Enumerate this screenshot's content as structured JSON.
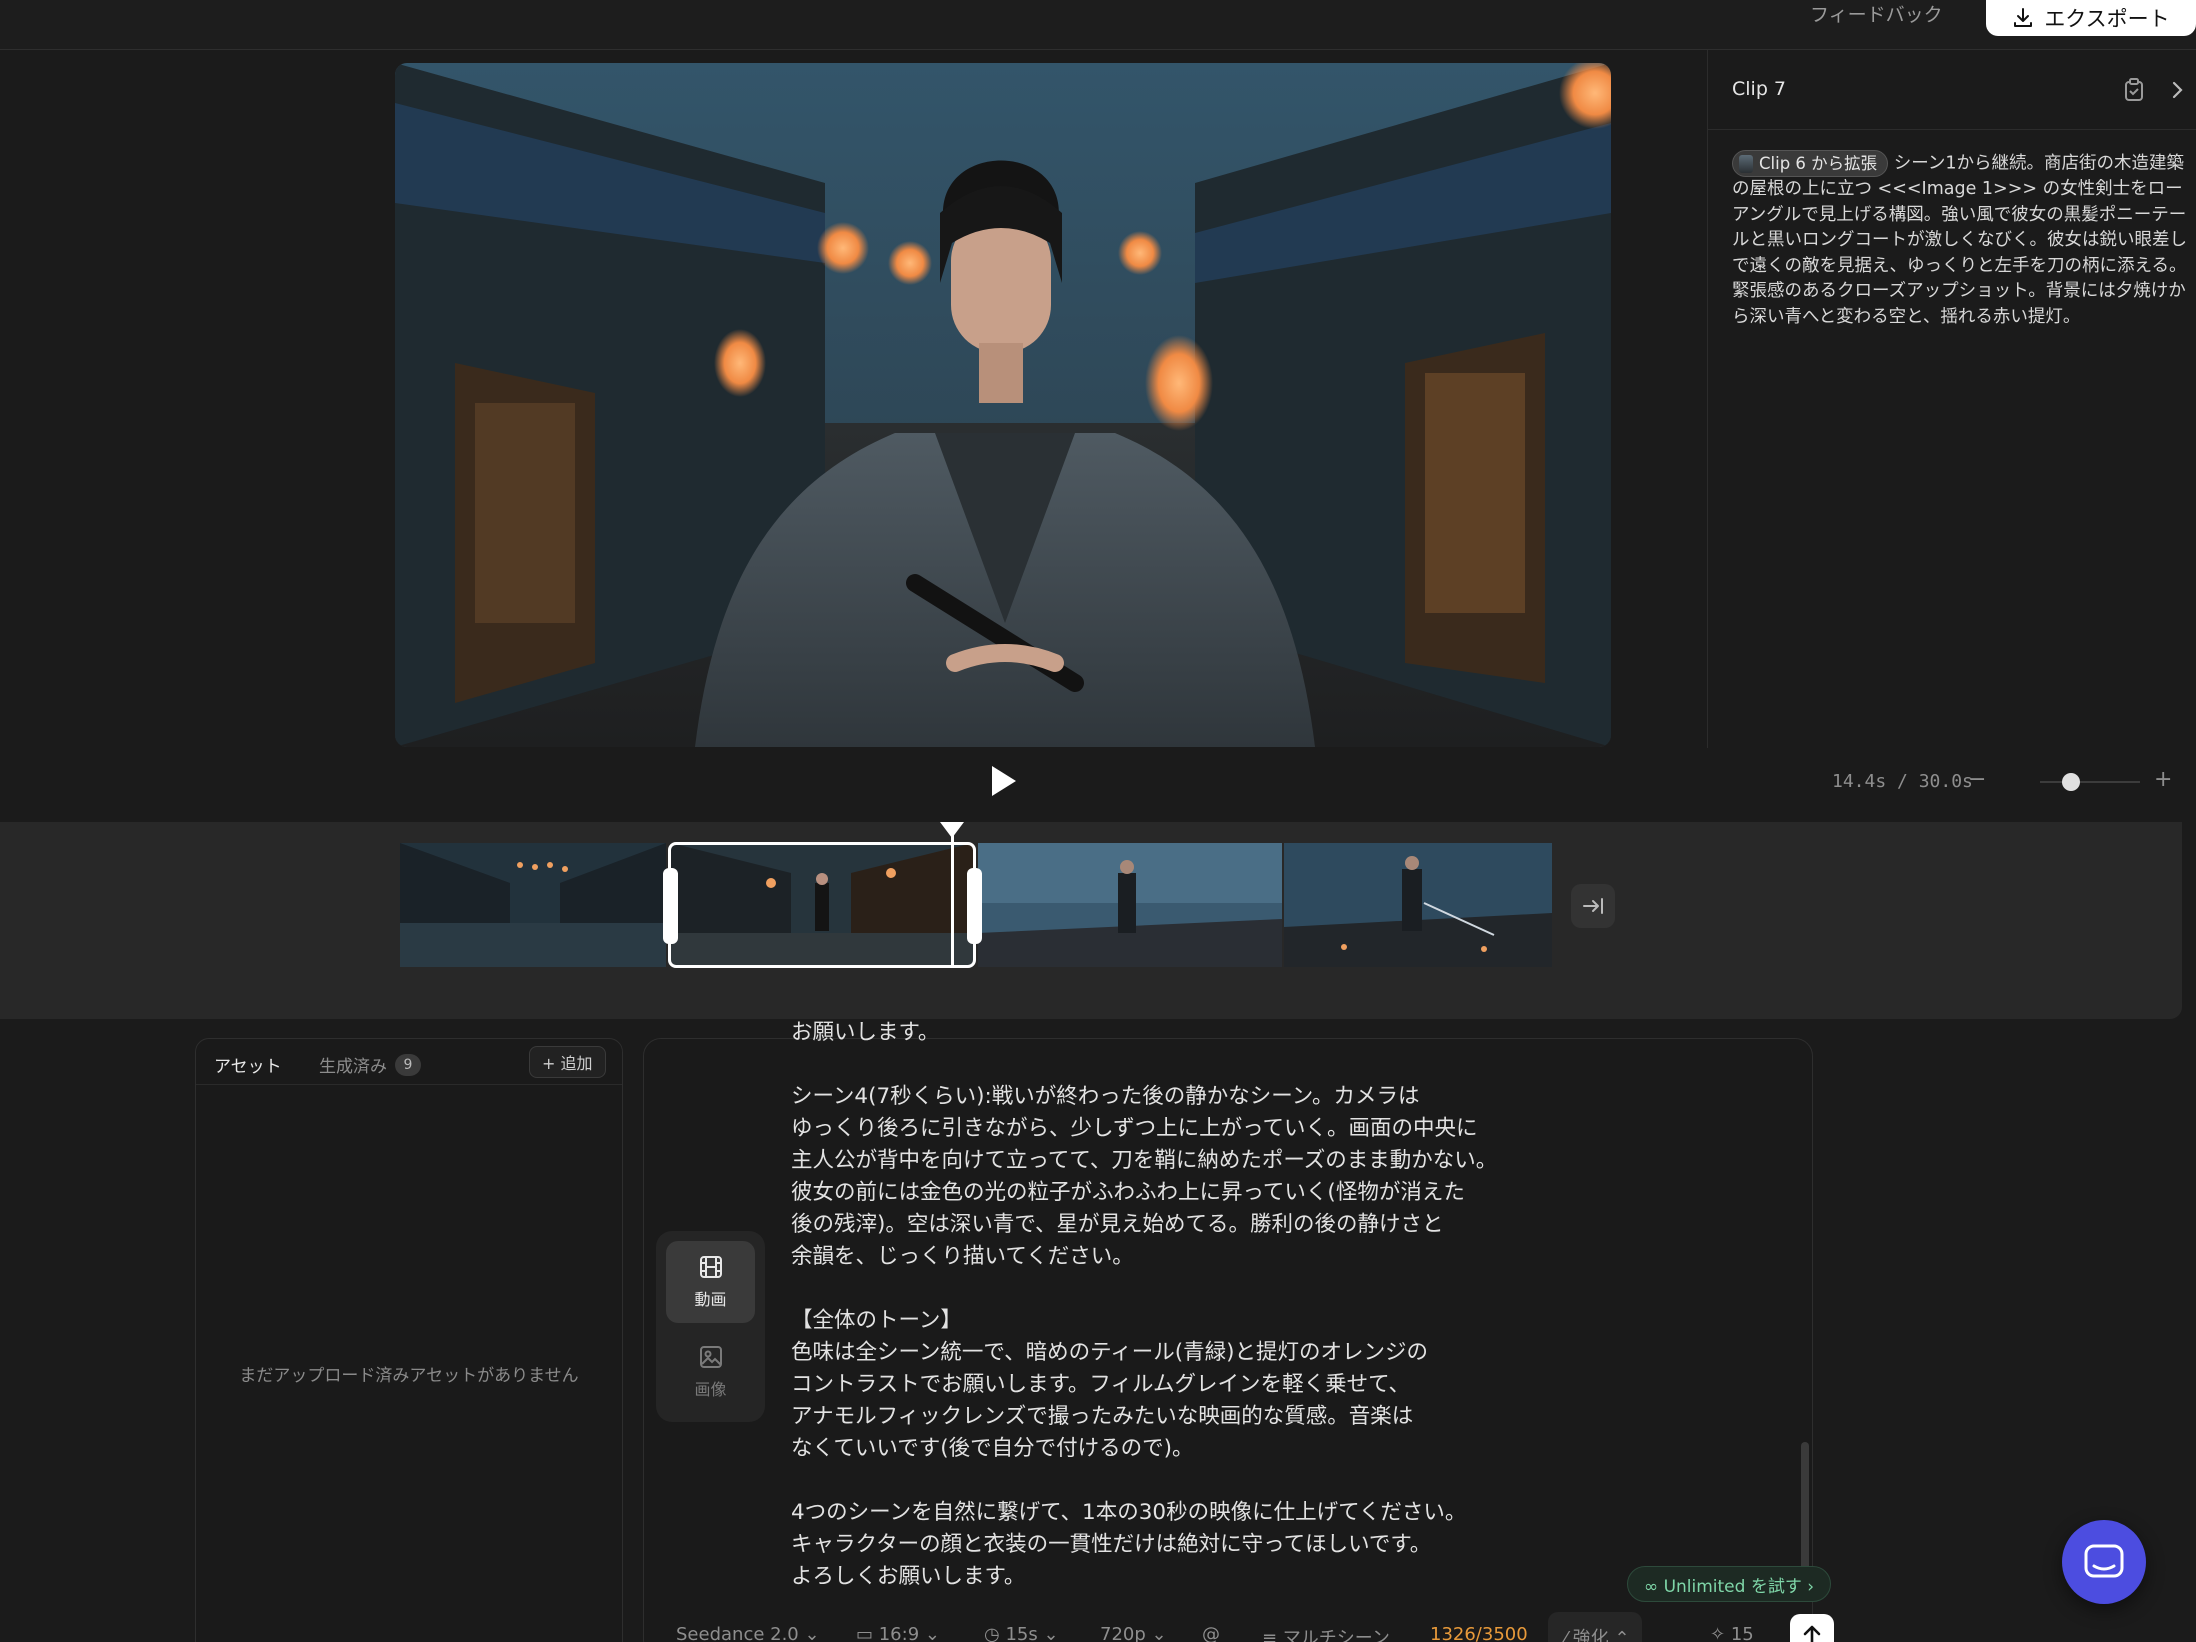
{
  "topbar": {
    "feedback_label": "フィードバック",
    "export_label": "エクスポート"
  },
  "clip_panel": {
    "title": "Clip 7",
    "chip_label": "Clip 6 から拡張",
    "description": "シーン1から継続。商店街の木造建築の屋根の上に立つ <<<Image 1>>> の女性剣士をローアングルで見上げる構図。強い風で彼女の黒髪ポニーテールと黒いロングコートが激しくなびく。彼女は鋭い眼差しで遠くの敵を見据え、ゆっくりと左手を刀の柄に添える。緊張感のあるクローズアップショット。背景には夕焼けから深い青へと変わる空と、揺れる赤い提灯。"
  },
  "playback": {
    "time_readout": "14.4s / 30.0s",
    "zoom_out": "−",
    "zoom_in": "+",
    "zoom_level": 0.3
  },
  "timeline": {
    "clips": [
      {
        "name": "clip-5"
      },
      {
        "name": "clip-6",
        "selected": true
      },
      {
        "name": "clip-7"
      },
      {
        "name": "clip-8"
      }
    ]
  },
  "assets": {
    "tab_assets": "アセット",
    "tab_generated": "生成済み",
    "generated_count": "9",
    "add_label": "+ 追加",
    "empty_text": "まだアップロード済みアセットがありません"
  },
  "modes": {
    "video": "動画",
    "image": "画像"
  },
  "prompt": {
    "text": "お願いします。\n\nシーン4(7秒くらい):戦いが終わった後の静かなシーン。カメラは\nゆっくり後ろに引きながら、少しずつ上に上がっていく。画面の中央に\n主人公が背中を向けて立ってて、刀を鞘に納めたポーズのまま動かない。\n彼女の前には金色の光の粒子がふわふわ上に昇っていく(怪物が消えた\n後の残滓)。空は深い青で、星が見え始めてる。勝利の後の静けさと\n余韻を、じっくり描いてください。\n\n【全体のトーン】\n色味は全シーン統一で、暗めのティール(青緑)と提灯のオレンジの\nコントラストでお願いします。フィルムグレインを軽く乗せて、\nアナモルフィックレンズで撮ったみたいな映画的な質感。音楽は\nなくていいです(後で自分で付けるので)。\n\n4つのシーンを自然に繋げて、1本の30秒の映像に仕上げてください。\nキャラクターの顔と衣装の一貫性だけは絶対に守ってほしいです。\nよろしくお願いします。"
  },
  "unlimited_label": "∞ Unlimited を試す ›",
  "toolbar": {
    "model": "Seedance 2.0 ⌄",
    "aspect": "16:9 ⌄",
    "duration": "15s ⌄",
    "resolution": "720p ⌄",
    "mention": "@",
    "multiscene": "マルチシーン",
    "char_count": "1326/3500",
    "enhance": "強化 ⌃",
    "credits": "15"
  },
  "colors": {
    "accent_white": "#ffffff",
    "char_count": "#e89a3a",
    "unlimited_text": "#7fd6a8",
    "chat_fab": "#4c4de0"
  }
}
